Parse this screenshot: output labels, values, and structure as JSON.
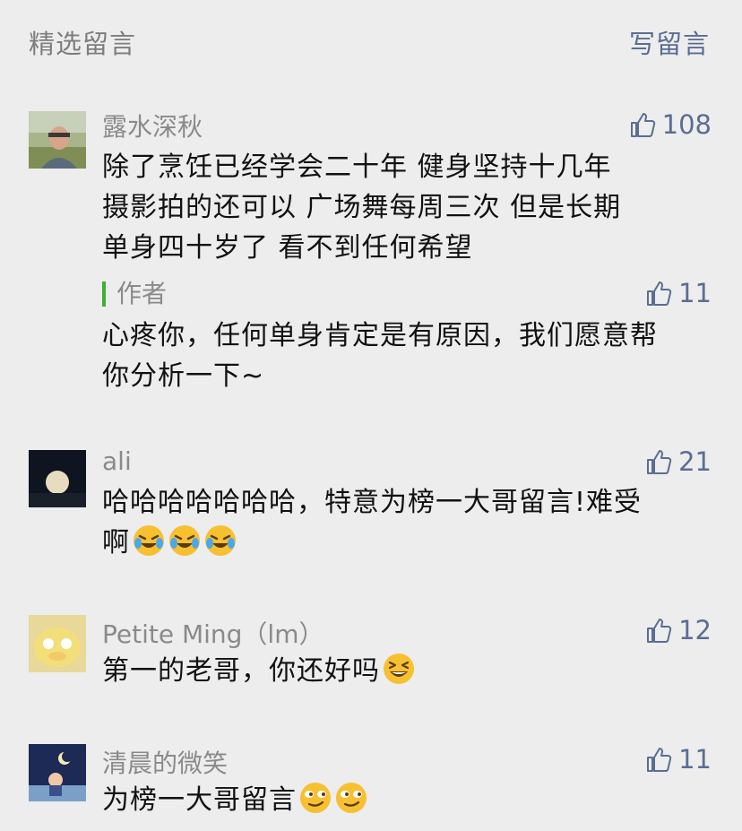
{
  "header": {
    "title": "精选留言",
    "write": "写留言"
  },
  "comments": [
    {
      "nick": "露水深秋",
      "likes": "108",
      "lines": [
        "除了烹饪已经学会二十年  健身坚持十几年",
        "摄影拍的还可以  广场舞每周三次   但是长期",
        "单身四十岁了  看不到任何希望"
      ],
      "reply": {
        "label": "作者",
        "likes": "11",
        "lines": [
          "心疼你，任何单身肯定是有原因，我们愿意帮",
          "你分析一下~"
        ]
      }
    },
    {
      "nick": "ali",
      "likes": "21",
      "lines": [
        "哈哈哈哈哈哈哈，特意为榜一大哥留言!难受",
        "啊"
      ]
    },
    {
      "nick": "Petite Ming（lm）",
      "likes": "12",
      "lines": [
        "第一的老哥，你还好吗"
      ]
    },
    {
      "nick": "清晨的微笑",
      "likes": "11",
      "lines": [
        "为榜一大哥留言"
      ]
    }
  ],
  "icons": {
    "like": "thumbs-up-icon",
    "emoji_cry_laugh": "crying-laughing-emoji-icon",
    "emoji_grin": "grinning-squint-emoji-icon",
    "emoji_smirk": "smirk-emoji-icon"
  },
  "colors": {
    "accent": "#5a6d93",
    "author_bar": "#3cb034",
    "background": "#ededed"
  }
}
